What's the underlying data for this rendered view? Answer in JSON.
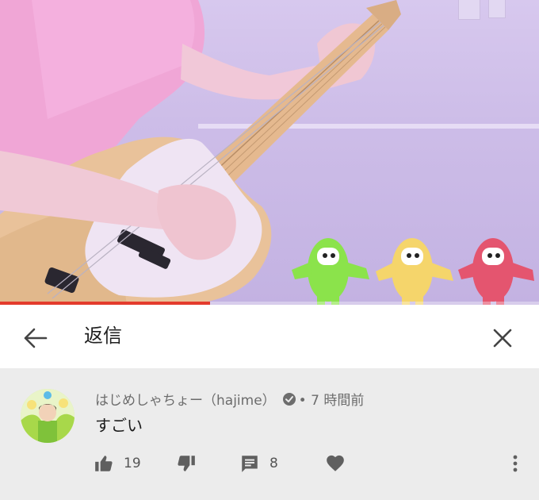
{
  "video": {
    "progress_fraction": 0.39,
    "progress_color": "#e43b2d"
  },
  "reply_panel": {
    "back_icon": "arrow-left-icon",
    "title": "返信",
    "close_icon": "close-icon"
  },
  "comment": {
    "author": "はじめしゃちょー（hajime）",
    "verified_icon": "verified-check-icon",
    "time": "• 7 時間前",
    "text": "すごい",
    "likes": "19",
    "reply_count": "8",
    "icons": {
      "like": "thumbs-up-icon",
      "dislike": "thumbs-down-icon",
      "reply": "comment-icon",
      "heart": "heart-icon",
      "more": "more-vert-icon"
    }
  }
}
